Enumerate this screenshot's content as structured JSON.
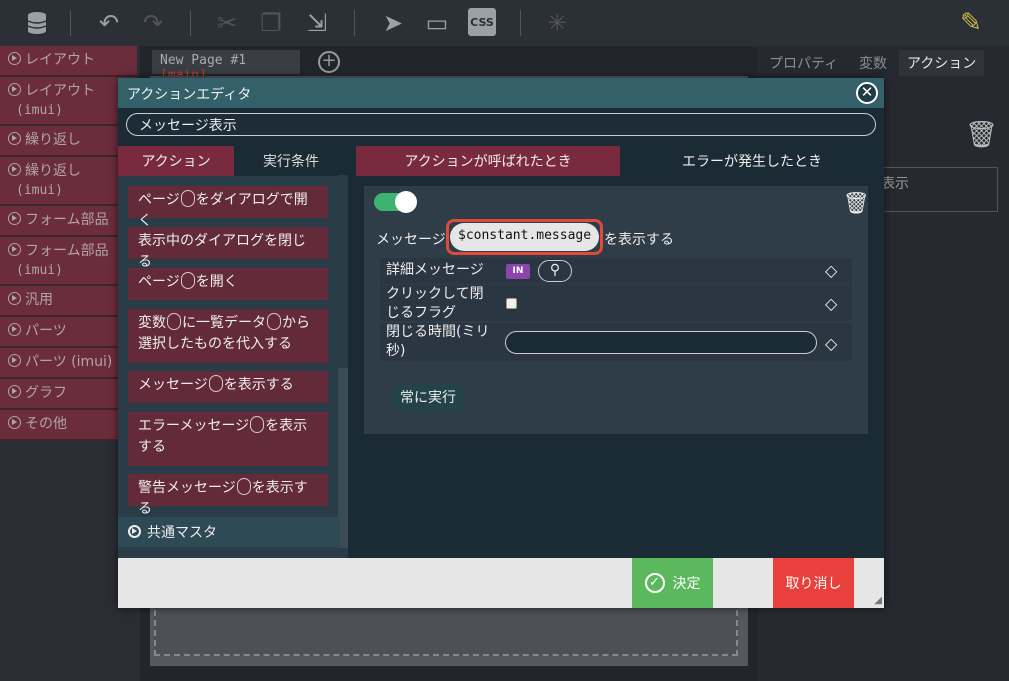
{
  "left_panel": {
    "items": [
      {
        "label": "レイアウト",
        "sub": ""
      },
      {
        "label": "レイアウト",
        "sub": "(imui)"
      },
      {
        "label": "繰り返し",
        "sub": ""
      },
      {
        "label": "繰り返し",
        "sub": "(imui)"
      },
      {
        "label": "フォーム部品",
        "sub": ""
      },
      {
        "label": "フォーム部品",
        "sub": "(imui)"
      },
      {
        "label": "汎用",
        "sub": ""
      },
      {
        "label": "パーツ",
        "sub": ""
      },
      {
        "label": "パーツ (imui)",
        "sub": ""
      },
      {
        "label": "グラフ",
        "sub": ""
      },
      {
        "label": "その他",
        "sub": ""
      }
    ]
  },
  "page_tab": {
    "name": "New Page #1",
    "tag": "[main]"
  },
  "right_panel": {
    "tabs": [
      "プロパティ",
      "変数",
      "アクション"
    ],
    "box_text": "表示"
  },
  "dialog": {
    "title": "アクションエディタ",
    "close_symbol": "✕",
    "action_name": "メッセージ表示",
    "left_tabs": [
      "アクション",
      "実行条件"
    ],
    "right_tabs": [
      "アクションが呼ばれたとき",
      "エラーが発生したとき"
    ],
    "actions": [
      {
        "pre": "ページ",
        "mid": "",
        "post": "をダイアログで開く",
        "holes": 1
      },
      {
        "pre": "表示中のダイアログを閉じる",
        "mid": "",
        "post": "",
        "holes": 0
      },
      {
        "pre": "ページ",
        "mid": "",
        "post": "を開く",
        "holes": 1
      },
      {
        "pre": "変数",
        "mid": "に一覧データ",
        "post": "から選択したものを代入する",
        "holes": 2
      },
      {
        "pre": "メッセージ",
        "mid": "",
        "post": "を表示する",
        "holes": 1
      },
      {
        "pre": "エラーメッセージ",
        "mid": "",
        "post": "を表示する",
        "holes": 1
      },
      {
        "pre": "警告メッセージ",
        "mid": "",
        "post": "を表示する",
        "holes": 1
      }
    ],
    "common_master": "共通マスタ",
    "card": {
      "message_label": "メッセージ",
      "message_value": "$constant.message",
      "message_suffix": "を表示する",
      "params": [
        {
          "label": "詳細メッセージ",
          "badge": "IN"
        },
        {
          "label": "クリックして閉じるフラグ"
        },
        {
          "label": "閉じる時間(ミリ秒)"
        }
      ],
      "always_run": "常に実行"
    },
    "ok_label": "決定",
    "cancel_label": "取り消し"
  },
  "colors": {
    "accent_tab": "#7a2a3e",
    "toggle_on": "#3cb371",
    "ok": "#5cb85c",
    "cancel": "#e8403c",
    "highlight": "#e04a3a"
  }
}
